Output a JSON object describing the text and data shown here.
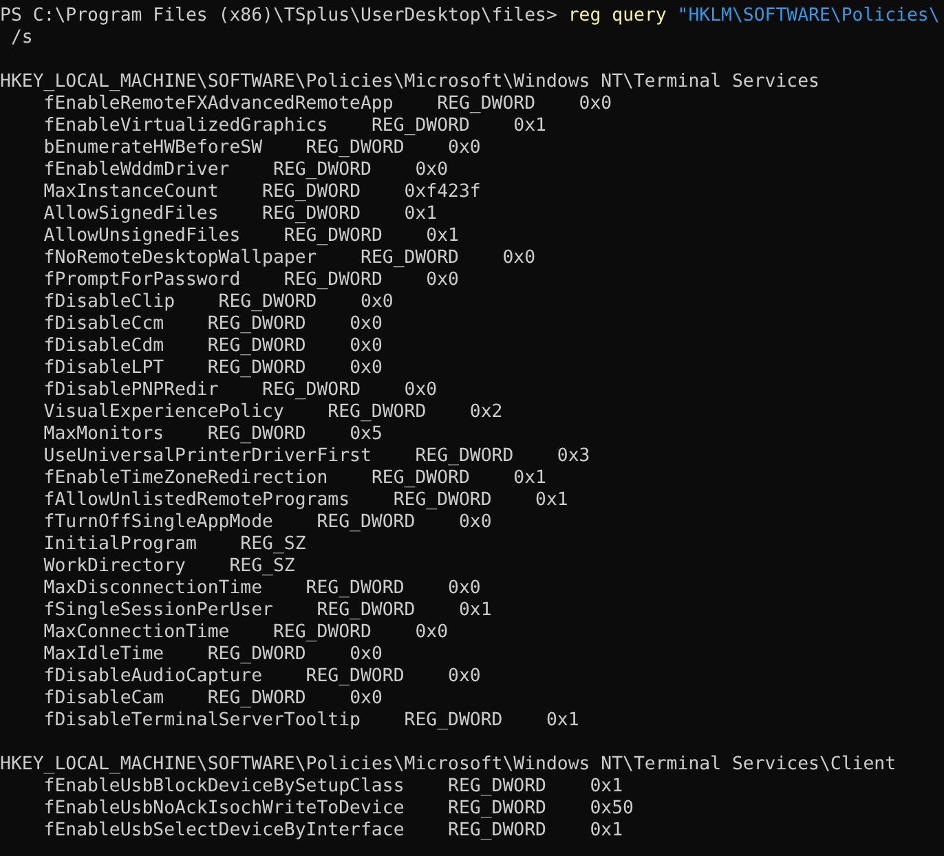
{
  "command": {
    "prompt": "PS C:\\Program Files (x86)\\TSplus\\UserDesktop\\files>",
    "tokens": [
      {
        "kind": "command",
        "text": "reg"
      },
      {
        "kind": "command",
        "text": "query"
      },
      {
        "kind": "string",
        "text": "\"HKLM\\SOFTWARE\\Policies\\"
      }
    ],
    "continuation": "/s"
  },
  "sections": [
    {
      "key": "HKEY_LOCAL_MACHINE\\SOFTWARE\\Policies\\Microsoft\\Windows NT\\Terminal Services",
      "values": [
        {
          "name": "fEnableRemoteFXAdvancedRemoteApp",
          "type": "REG_DWORD",
          "data": "0x0"
        },
        {
          "name": "fEnableVirtualizedGraphics",
          "type": "REG_DWORD",
          "data": "0x1"
        },
        {
          "name": "bEnumerateHWBeforeSW",
          "type": "REG_DWORD",
          "data": "0x0"
        },
        {
          "name": "fEnableWddmDriver",
          "type": "REG_DWORD",
          "data": "0x0"
        },
        {
          "name": "MaxInstanceCount",
          "type": "REG_DWORD",
          "data": "0xf423f"
        },
        {
          "name": "AllowSignedFiles",
          "type": "REG_DWORD",
          "data": "0x1"
        },
        {
          "name": "AllowUnsignedFiles",
          "type": "REG_DWORD",
          "data": "0x1"
        },
        {
          "name": "fNoRemoteDesktopWallpaper",
          "type": "REG_DWORD",
          "data": "0x0"
        },
        {
          "name": "fPromptForPassword",
          "type": "REG_DWORD",
          "data": "0x0"
        },
        {
          "name": "fDisableClip",
          "type": "REG_DWORD",
          "data": "0x0"
        },
        {
          "name": "fDisableCcm",
          "type": "REG_DWORD",
          "data": "0x0"
        },
        {
          "name": "fDisableCdm",
          "type": "REG_DWORD",
          "data": "0x0"
        },
        {
          "name": "fDisableLPT",
          "type": "REG_DWORD",
          "data": "0x0"
        },
        {
          "name": "fDisablePNPRedir",
          "type": "REG_DWORD",
          "data": "0x0"
        },
        {
          "name": "VisualExperiencePolicy",
          "type": "REG_DWORD",
          "data": "0x2"
        },
        {
          "name": "MaxMonitors",
          "type": "REG_DWORD",
          "data": "0x5"
        },
        {
          "name": "UseUniversalPrinterDriverFirst",
          "type": "REG_DWORD",
          "data": "0x3"
        },
        {
          "name": "fEnableTimeZoneRedirection",
          "type": "REG_DWORD",
          "data": "0x1"
        },
        {
          "name": "fAllowUnlistedRemotePrograms",
          "type": "REG_DWORD",
          "data": "0x1"
        },
        {
          "name": "fTurnOffSingleAppMode",
          "type": "REG_DWORD",
          "data": "0x0"
        },
        {
          "name": "InitialProgram",
          "type": "REG_SZ"
        },
        {
          "name": "WorkDirectory",
          "type": "REG_SZ"
        },
        {
          "name": "MaxDisconnectionTime",
          "type": "REG_DWORD",
          "data": "0x0"
        },
        {
          "name": "fSingleSessionPerUser",
          "type": "REG_DWORD",
          "data": "0x1"
        },
        {
          "name": "MaxConnectionTime",
          "type": "REG_DWORD",
          "data": "0x0"
        },
        {
          "name": "MaxIdleTime",
          "type": "REG_DWORD",
          "data": "0x0"
        },
        {
          "name": "fDisableAudioCapture",
          "type": "REG_DWORD",
          "data": "0x0"
        },
        {
          "name": "fDisableCam",
          "type": "REG_DWORD",
          "data": "0x0"
        },
        {
          "name": "fDisableTerminalServerTooltip",
          "type": "REG_DWORD",
          "data": "0x1"
        }
      ]
    },
    {
      "key": "HKEY_LOCAL_MACHINE\\SOFTWARE\\Policies\\Microsoft\\Windows NT\\Terminal Services\\Client",
      "values": [
        {
          "name": "fEnableUsbBlockDeviceBySetupClass",
          "type": "REG_DWORD",
          "data": "0x1"
        },
        {
          "name": "fEnableUsbNoAckIsochWriteToDevice",
          "type": "REG_DWORD",
          "data": "0x50"
        },
        {
          "name": "fEnableUsbSelectDeviceByInterface",
          "type": "REG_DWORD",
          "data": "0x1"
        }
      ]
    }
  ]
}
